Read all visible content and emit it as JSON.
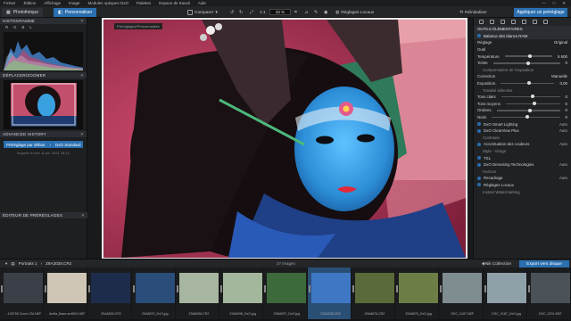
{
  "menu": [
    "Fichier",
    "Édition",
    "Affichage",
    "Image",
    "Modules optiques DxO",
    "Palettes",
    "Espace de travail",
    "Aide"
  ],
  "toolbar": {
    "tab_phototheque": "Photothèque",
    "tab_personnaliser": "Personnaliser",
    "compare": "Comparer",
    "zoom": "33 %",
    "local": "Réglages Locaux",
    "reinit": "Réinitialiser",
    "apply_preset": "Appliquer un préréglage"
  },
  "left": {
    "histogram": "HISTOGRAMME",
    "channels": [
      "R",
      "G",
      "B",
      "L"
    ],
    "navigator": "DÉPLACER/ZOOMER",
    "history": "ADVANCED HISTORY",
    "history_item_a": "Préréglage par défaut",
    "history_item_b": "DxO Standard",
    "history_sub": "Importé le mer. 6 oct. 2021 18:12",
    "preset_editor": "ÉDITEUR DE PRÉRÉGLAGES"
  },
  "center": {
    "crumb": "Préréglages/Personnalisés"
  },
  "right": {
    "tools_title": "OUTILS ÉLÉMENTAIRES",
    "rows": [
      {
        "label": "Balance des blancs RAW",
        "type": "sec"
      },
      {
        "label": "Réglage",
        "value": "Original",
        "type": "row"
      },
      {
        "label": "Outil",
        "value": "",
        "type": "row"
      },
      {
        "label": "Température",
        "value": "5 500",
        "type": "slider",
        "pos": 0.5
      },
      {
        "label": "Teinte",
        "value": "0",
        "type": "slider",
        "pos": 0.5
      },
      {
        "label": "Compensation de l'exposition",
        "type": "sub"
      },
      {
        "label": "Correction",
        "value": "Manuelle",
        "type": "row"
      },
      {
        "label": "Exposition",
        "value": "0,00",
        "type": "slider",
        "pos": 0.5
      },
      {
        "label": "Tonalité sélective",
        "type": "sub"
      },
      {
        "label": "Tons clairs",
        "value": "0",
        "type": "slider",
        "pos": 0.5
      },
      {
        "label": "Tons moyens",
        "value": "0",
        "type": "slider",
        "pos": 0.5
      },
      {
        "label": "Ombres",
        "value": "0",
        "type": "slider",
        "pos": 0.5
      },
      {
        "label": "Noirs",
        "value": "0",
        "type": "slider",
        "pos": 0.5
      },
      {
        "label": "DxO Smart Lighting",
        "value": "Auto",
        "type": "toggle"
      },
      {
        "label": "DxO ClearView Plus",
        "value": "Auto",
        "type": "toggle"
      },
      {
        "label": "Contraste",
        "type": "sub"
      },
      {
        "label": "Accentuation des couleurs",
        "value": "Auto",
        "type": "toggle"
      },
      {
        "label": "Style - Virage",
        "type": "sub"
      },
      {
        "label": "TSL",
        "type": "toggle",
        "value": ""
      },
      {
        "label": "DxO Denoising Technologies",
        "value": "Auto",
        "type": "toggle"
      },
      {
        "label": "Horizon",
        "type": "sub"
      },
      {
        "label": "Recadrage",
        "value": "Auto",
        "type": "toggle"
      },
      {
        "label": "Réglages Locaux",
        "value": "",
        "type": "toggle"
      },
      {
        "label": "Instant Watermarking",
        "type": "sub"
      }
    ]
  },
  "filmstrip": {
    "folder": "Portraits 1",
    "file": "Z9A3028.CR2",
    "count": "27 images",
    "nik": "Nik Collection",
    "export": "Export vers disque",
    "thumbs": [
      {
        "cap": "...100755 Cover-CM.NEF",
        "color": "#3a3f48"
      },
      {
        "cap": "Arella_Base-arrW04.NEF",
        "color": "#cfc6b5"
      },
      {
        "cap": "Z9A6839.CR2",
        "color": "#1c2c4a"
      },
      {
        "cap": "Z9A6870_DxO.jpg",
        "color": "#2a4d7a"
      },
      {
        "cap": "Z9A6098.CR2",
        "color": "#a7b6a0"
      },
      {
        "cap": "Z9A6098_DxO.jpg",
        "color": "#a3b79c"
      },
      {
        "cap": "Z9A6097_DxO.jpg",
        "color": "#3d6a3b"
      },
      {
        "cap": "Z9A3028.CR2",
        "color": "#3e78c4"
      },
      {
        "cap": "Z9A8876.CR2",
        "color": "#5a6a3a"
      },
      {
        "cap": "Z9A8876_DxO.jpg",
        "color": "#6c7e46"
      },
      {
        "cap": "DSC_0187.NEF",
        "color": "#7f8c90"
      },
      {
        "cap": "DSC_0187_DxO.jpg",
        "color": "#8ea0a8"
      },
      {
        "cap": "DSC_0201.NEF",
        "color": "#4a5258"
      }
    ]
  }
}
